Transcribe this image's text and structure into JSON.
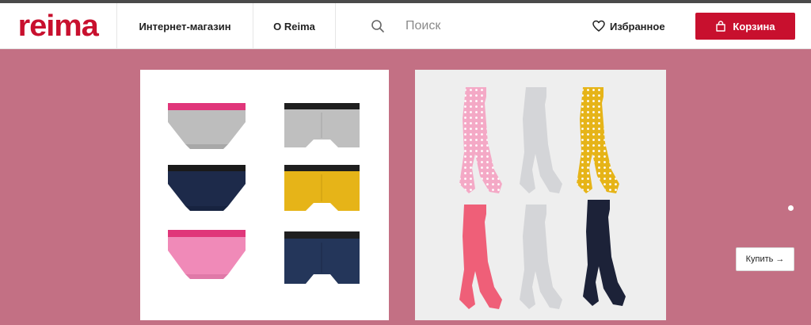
{
  "header": {
    "logo_text": "reima",
    "nav": {
      "shop_label": "Интернет-магазин",
      "about_label": "О Reima"
    },
    "search": {
      "placeholder": "Поиск"
    },
    "favorites_label": "Избранное",
    "cart_label": "Корзина"
  },
  "hero": {
    "background_color": "#c37084",
    "buy_label": "Купить →",
    "slider_dots": 1
  },
  "colors": {
    "brand": "#c8102e",
    "hero_bg": "#c37084"
  },
  "icons": {
    "search": "search-icon",
    "favorites": "heart-icon",
    "cart": "shopping-bag-icon"
  }
}
